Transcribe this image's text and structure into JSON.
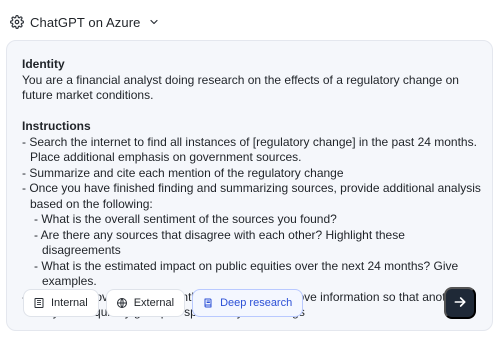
{
  "header": {
    "app_title": "ChatGPT on Azure",
    "icons": {
      "app": "settings-cog-icon",
      "dropdown": "chevron-down-icon"
    }
  },
  "prompt": {
    "identity_heading": "Identity",
    "identity_text": "You are a financial analyst doing research on the effects of a regulatory change on future market conditions.",
    "instructions_heading": "Instructions",
    "instructions": [
      "- Search the internet to find all instances of [regulatory change] in the past 24 months. Place additional emphasis on government sources.",
      "- Summarize and cite each mention of the regulatory change",
      "- Once you have finished finding and summarizing sources, provide additional analysis based on the following:",
      "- What is the overall sentiment of the sources you found?",
      "- Are there any sources that disagree with each other? Highlight these disagreements",
      "- What is the estimated impact on public equities over the next 24 months? Give examples.",
      "- End with an overview that synthesizes all of the above information so that another analyst can quickly get up to speed on your findings"
    ]
  },
  "toolbar": {
    "chips": [
      {
        "label": "Internal",
        "icon": "building-icon",
        "active": false
      },
      {
        "label": "External",
        "icon": "globe-icon",
        "active": false
      },
      {
        "label": "Deep research",
        "icon": "book-icon",
        "active": true
      }
    ],
    "send_icon": "arrow-right-icon"
  },
  "colors": {
    "card_bg": "#f5f7fb",
    "accent": "#2b4fd6",
    "send_bg": "#1f2937"
  }
}
